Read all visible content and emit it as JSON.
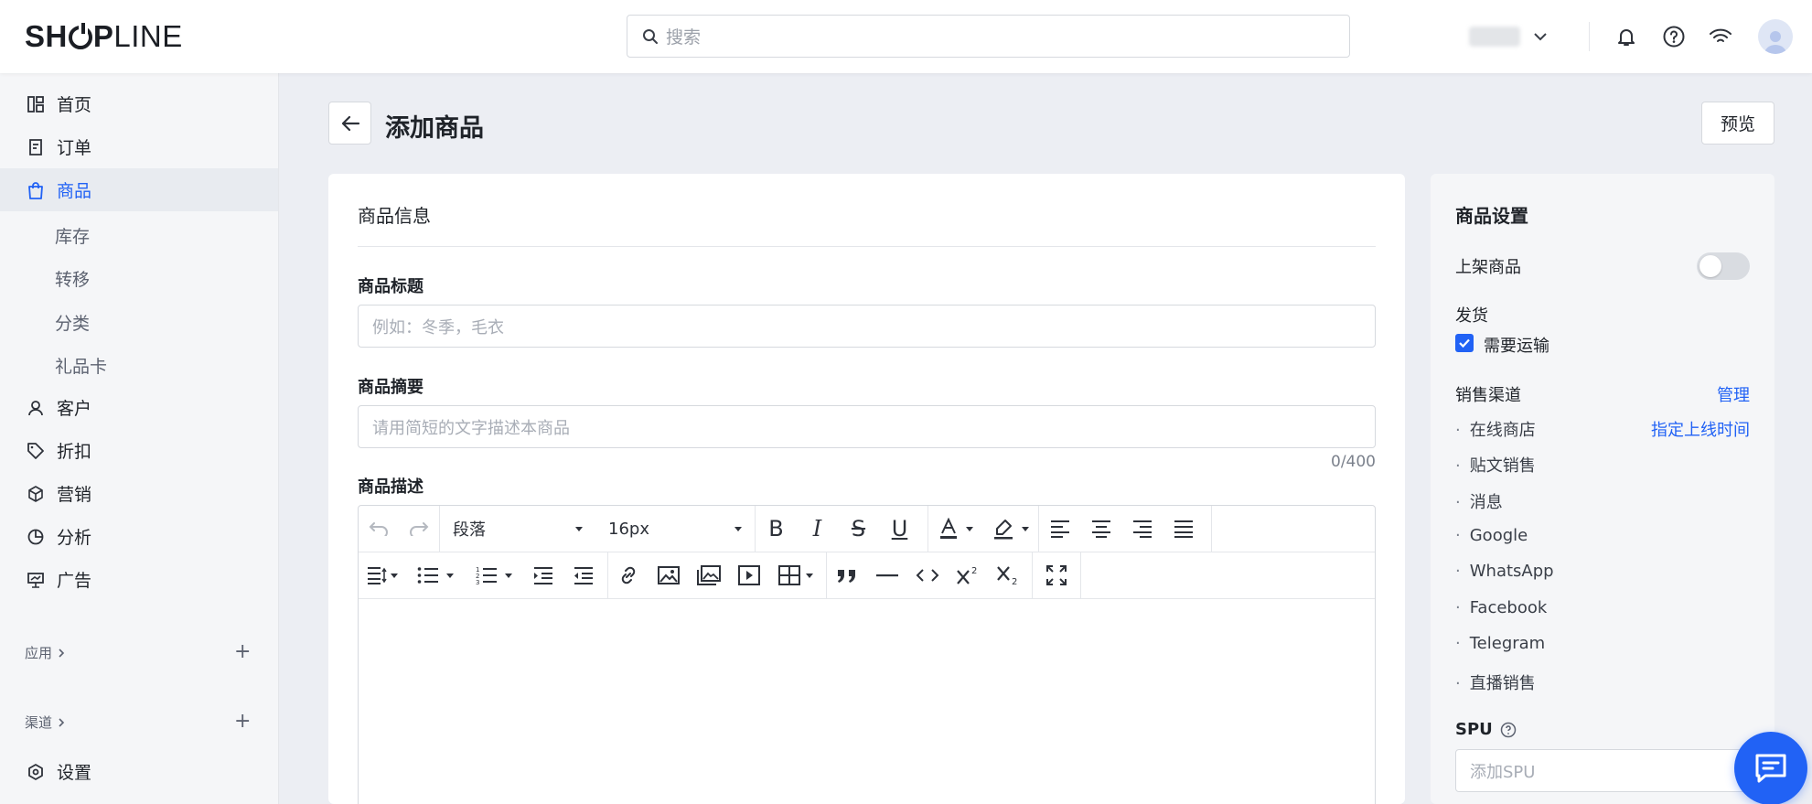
{
  "header": {
    "logo_text": "SHOPLINE",
    "search_placeholder": "搜索"
  },
  "sidebar": {
    "items": [
      {
        "label": "首页",
        "icon": "dashboard-icon"
      },
      {
        "label": "订单",
        "icon": "order-icon"
      },
      {
        "label": "商品",
        "icon": "bag-icon",
        "active": true
      },
      {
        "label": "客户",
        "icon": "user-icon"
      },
      {
        "label": "折扣",
        "icon": "tag-icon"
      },
      {
        "label": "营销",
        "icon": "cube-icon"
      },
      {
        "label": "分析",
        "icon": "pie-chart-icon"
      },
      {
        "label": "广告",
        "icon": "billboard-icon"
      }
    ],
    "sub_items": [
      "库存",
      "转移",
      "分类",
      "礼品卡"
    ],
    "groups": [
      {
        "label": "应用"
      },
      {
        "label": "渠道"
      }
    ],
    "settings_label": "设置"
  },
  "page": {
    "title": "添加商品",
    "preview_label": "预览"
  },
  "product_info": {
    "section_title": "商品信息",
    "title_label": "商品标题",
    "title_placeholder": "例如：冬季，毛衣",
    "summary_label": "商品摘要",
    "summary_placeholder": "请用简短的文字描述本商品",
    "summary_counter": "0/400",
    "description_label": "商品描述",
    "editor": {
      "block_format": "段落",
      "font_size": "16px"
    }
  },
  "settings": {
    "title": "商品设置",
    "publish_label": "上架商品",
    "publish_on": false,
    "shipping_label": "发货",
    "requires_shipping_label": "需要运输",
    "requires_shipping_checked": true,
    "channels_label": "销售渠道",
    "manage_label": "管理",
    "schedule_label": "指定上线时间",
    "channels": [
      "在线商店",
      "贴文销售",
      "消息",
      "Google",
      "WhatsApp",
      "Facebook",
      "Telegram",
      "直播销售"
    ],
    "spu_label": "SPU",
    "spu_placeholder": "添加SPU"
  },
  "colors": {
    "accent": "#2162f5",
    "background": "#eceef3"
  }
}
